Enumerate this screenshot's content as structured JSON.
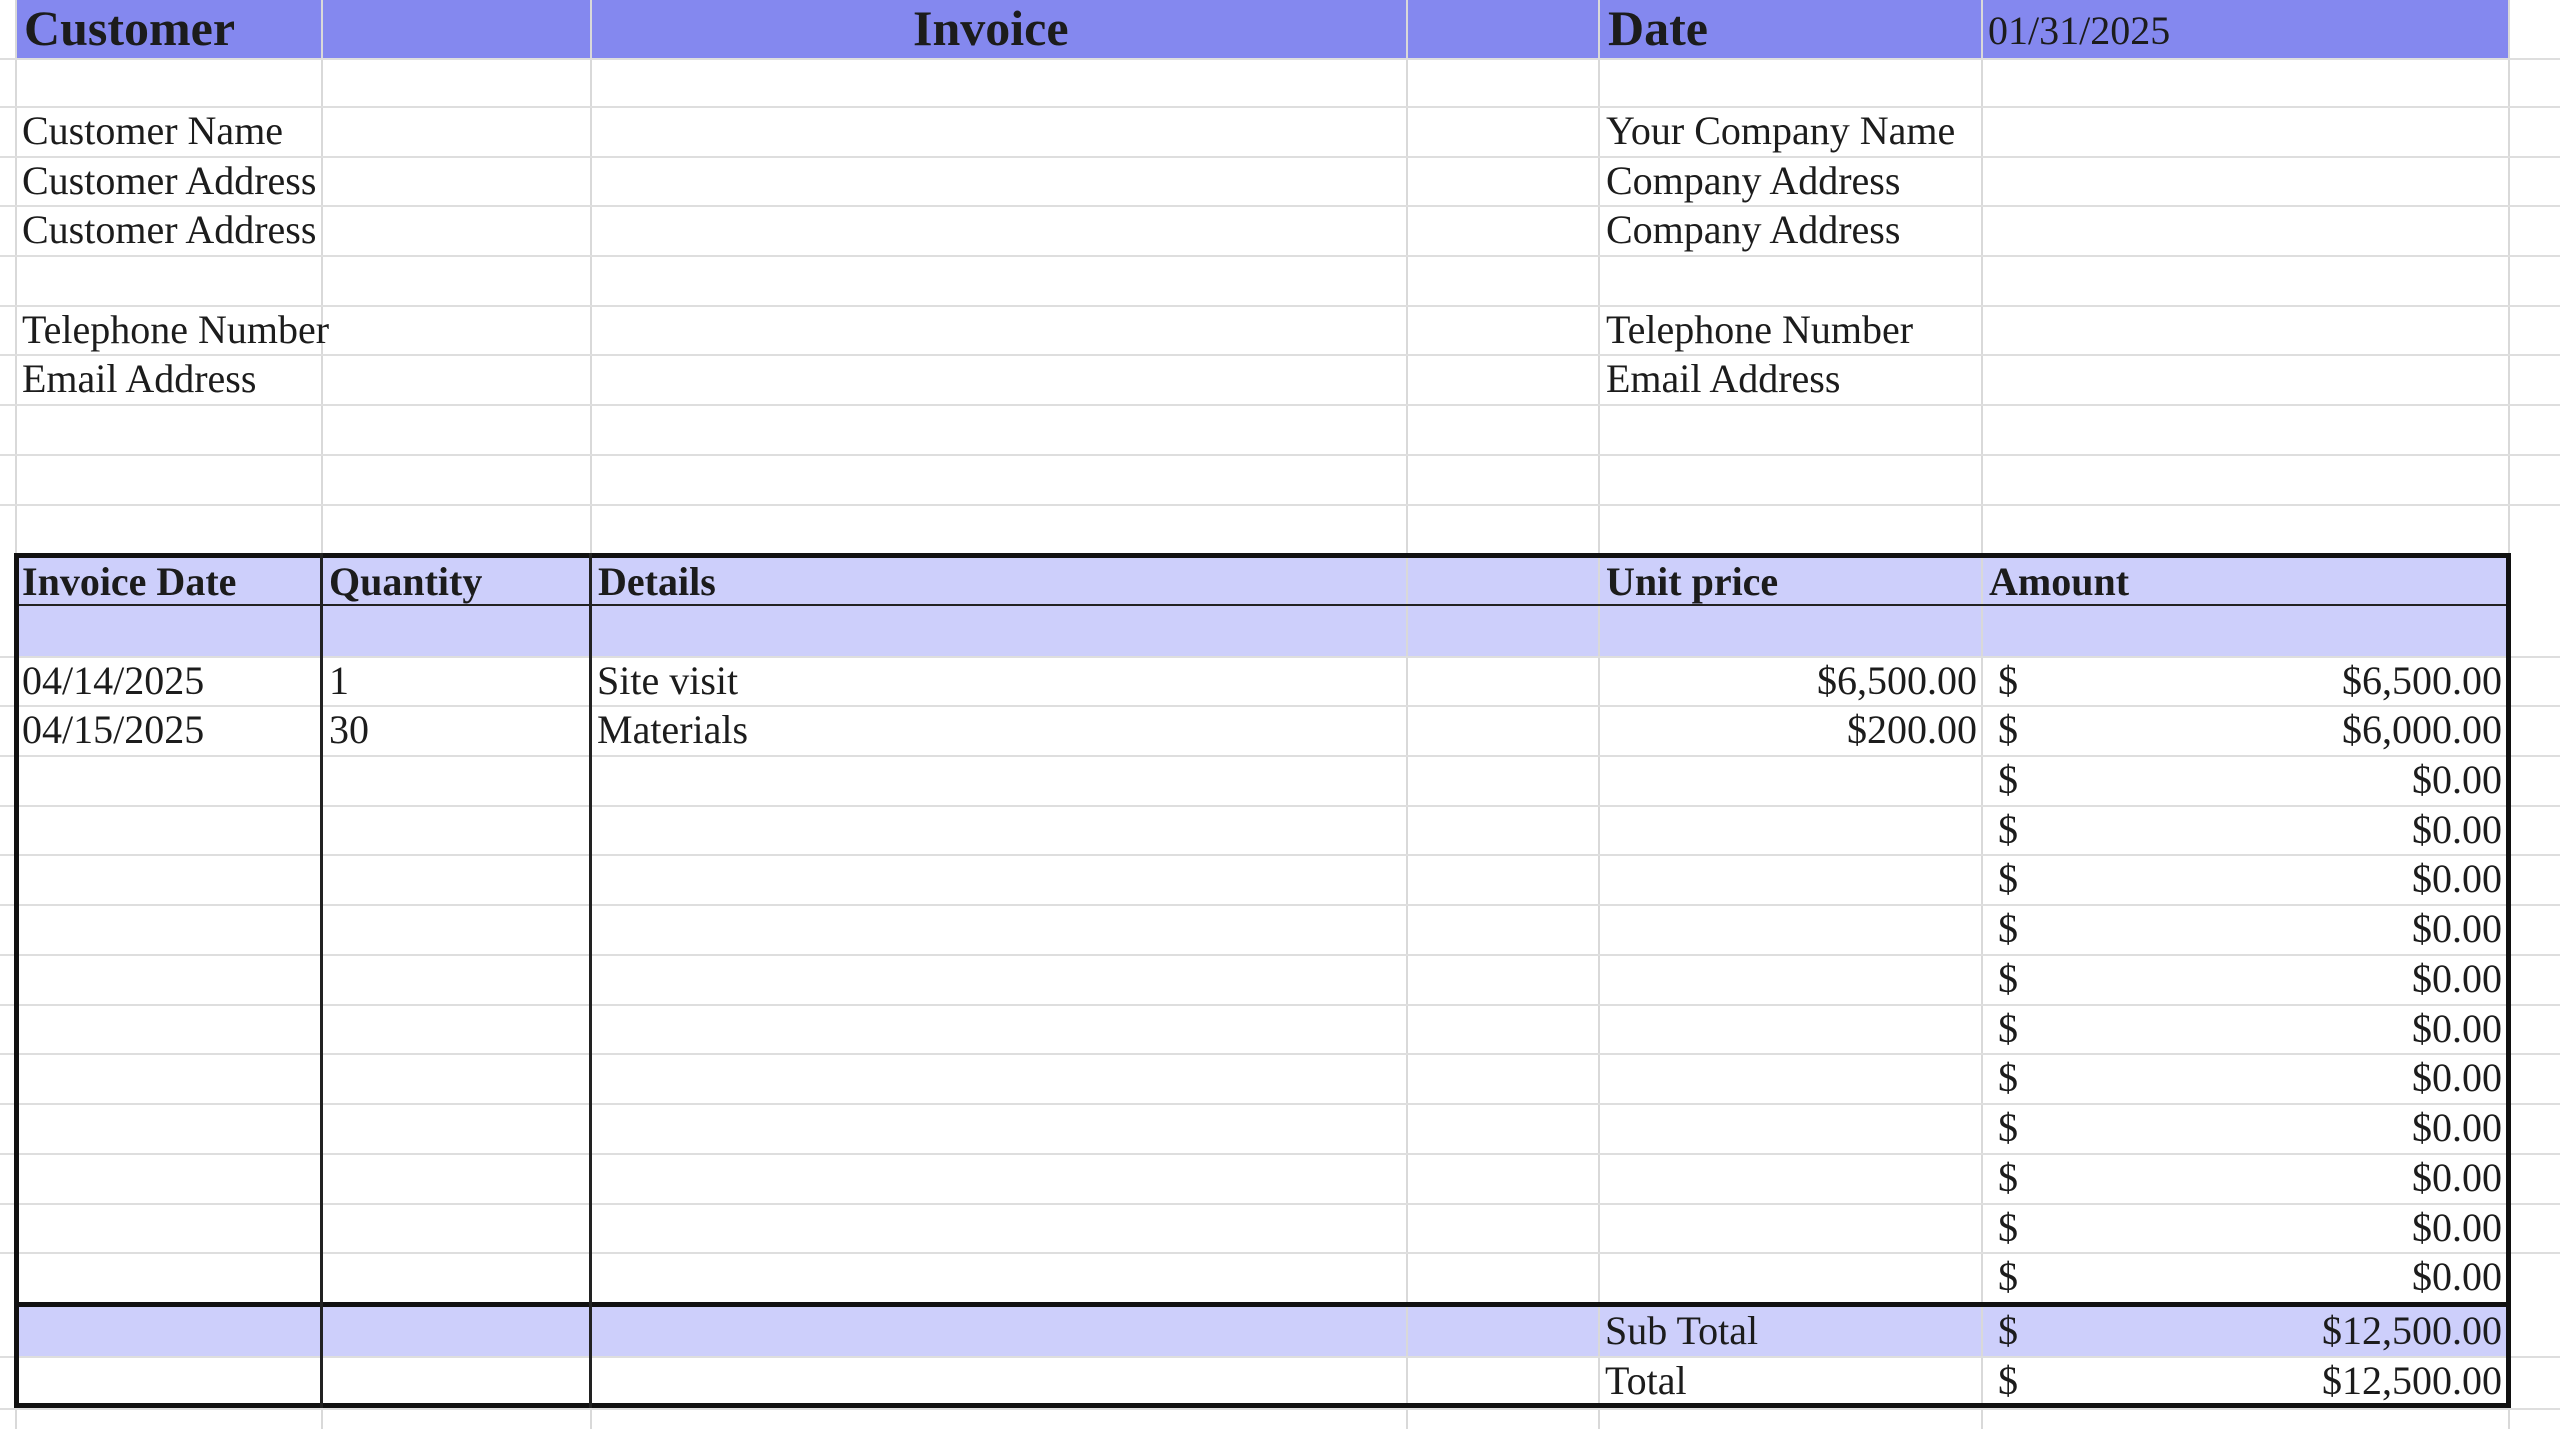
{
  "colors": {
    "header_band": "#8488ef",
    "table_band": "#cdcffb",
    "grid": "#d9d9d9",
    "border": "#111111"
  },
  "header": {
    "customer": "Customer",
    "invoice": "Invoice",
    "date_label": "Date",
    "date_value": "01/31/2025"
  },
  "customer": {
    "name": "Customer Name",
    "address1": "Customer Address",
    "address2": "Customer Address",
    "telephone": "Telephone Number",
    "email": "Email Address"
  },
  "company": {
    "name": "Your Company Name",
    "address1": "Company Address",
    "address2": "Company Address",
    "telephone": "Telephone Number",
    "email": "Email Address"
  },
  "table": {
    "columns": [
      "Invoice Date",
      "Quantity",
      "Details",
      "Unit price",
      "Amount"
    ],
    "rows": [
      {
        "date": "04/14/2025",
        "qty": "1",
        "details": "Site visit",
        "unit": "$6,500.00",
        "cur": "$",
        "amount": "$6,500.00"
      },
      {
        "date": "04/15/2025",
        "qty": "30",
        "details": "Materials",
        "unit": "$200.00",
        "cur": "$",
        "amount": "$6,000.00"
      },
      {
        "date": "",
        "qty": "",
        "details": "",
        "unit": "",
        "cur": "$",
        "amount": "$0.00"
      },
      {
        "date": "",
        "qty": "",
        "details": "",
        "unit": "",
        "cur": "$",
        "amount": "$0.00"
      },
      {
        "date": "",
        "qty": "",
        "details": "",
        "unit": "",
        "cur": "$",
        "amount": "$0.00"
      },
      {
        "date": "",
        "qty": "",
        "details": "",
        "unit": "",
        "cur": "$",
        "amount": "$0.00"
      },
      {
        "date": "",
        "qty": "",
        "details": "",
        "unit": "",
        "cur": "$",
        "amount": "$0.00"
      },
      {
        "date": "",
        "qty": "",
        "details": "",
        "unit": "",
        "cur": "$",
        "amount": "$0.00"
      },
      {
        "date": "",
        "qty": "",
        "details": "",
        "unit": "",
        "cur": "$",
        "amount": "$0.00"
      },
      {
        "date": "",
        "qty": "",
        "details": "",
        "unit": "",
        "cur": "$",
        "amount": "$0.00"
      },
      {
        "date": "",
        "qty": "",
        "details": "",
        "unit": "",
        "cur": "$",
        "amount": "$0.00"
      },
      {
        "date": "",
        "qty": "",
        "details": "",
        "unit": "",
        "cur": "$",
        "amount": "$0.00"
      },
      {
        "date": "",
        "qty": "",
        "details": "",
        "unit": "",
        "cur": "$",
        "amount": "$0.00"
      }
    ],
    "subtotal": {
      "label": "Sub Total",
      "cur": "$",
      "amount": "$12,500.00"
    },
    "total": {
      "label": "Total",
      "cur": "$",
      "amount": "$12,500.00"
    }
  }
}
